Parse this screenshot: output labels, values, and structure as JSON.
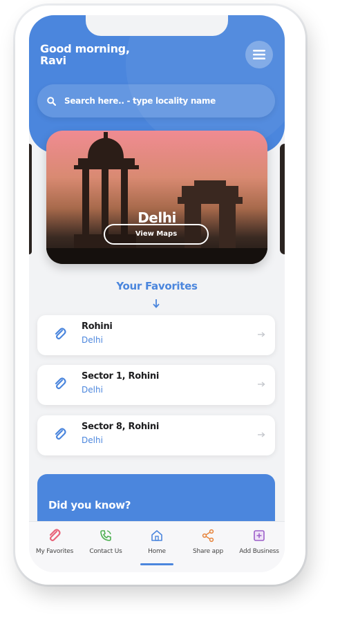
{
  "header": {
    "greeting_line1": "Good morning,",
    "greeting_line2": "Ravi"
  },
  "search": {
    "placeholder": "Search here.. - type locality name"
  },
  "hero": {
    "city": "Delhi",
    "button_label": "View Maps"
  },
  "favorites": {
    "title": "Your Favorites",
    "items": [
      {
        "name": "Rohini",
        "city": "Delhi"
      },
      {
        "name": "Sector 1, Rohini",
        "city": "Delhi"
      },
      {
        "name": "Sector 8, Rohini",
        "city": "Delhi"
      }
    ]
  },
  "did_you_know": {
    "title": "Did you know?"
  },
  "bottom_nav": {
    "items": [
      {
        "label": "My Favorites",
        "icon": "paperclip-icon",
        "active": false
      },
      {
        "label": "Contact Us",
        "icon": "phone-icon",
        "active": false
      },
      {
        "label": "Home",
        "icon": "home-icon",
        "active": true
      },
      {
        "label": "Share app",
        "icon": "share-icon",
        "active": false
      },
      {
        "label": "Add Business",
        "icon": "plus-square-icon",
        "active": false
      }
    ]
  },
  "colors": {
    "primary": "#4b86dd",
    "background": "#f2f3f5",
    "favorites_icon": "#e8647a",
    "contact_icon": "#4caf50",
    "home_icon": "#4b86dd",
    "share_icon": "#e6833a",
    "add_business_icon": "#9c5ec9"
  }
}
